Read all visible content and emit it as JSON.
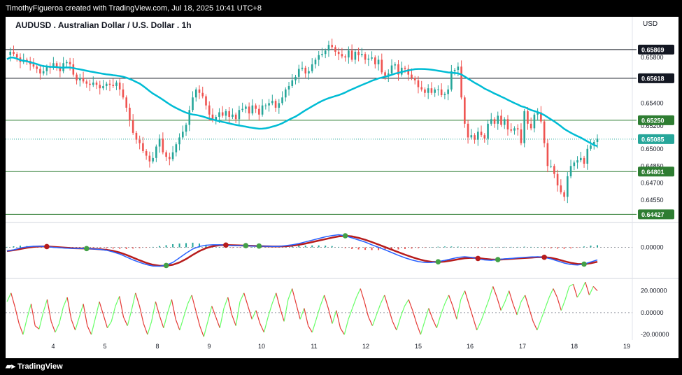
{
  "header": {
    "credit": "TimothyFigueroa created with TradingView.com, Jul 18, 2025 10:41 UTC+8"
  },
  "footer": {
    "brand": "TradingView"
  },
  "chart_title": "AUDUSD . Australian Dollar / U.S. Dollar . 1h",
  "currency": "USD",
  "colors": {
    "up": "#26a69a",
    "down": "#ef5350",
    "ma": "#00bcd4",
    "macd_fast": "#2962ff",
    "macd_slow": "#b71c1c",
    "rsi_up": "#66ff66",
    "rsi_down": "#e53935",
    "hist_up": "#26a69a",
    "hist_down": "#ef5350"
  },
  "chart_data": [
    {
      "type": "line",
      "series_kind": "price_candles",
      "x_ticks": [
        "4",
        "5",
        "8",
        "9",
        "10",
        "11",
        "12",
        "15",
        "16",
        "17",
        "18",
        "19"
      ],
      "y_ticks": [
        "0.65800",
        "0.65400",
        "0.65200",
        "0.65000",
        "0.64850",
        "0.64700",
        "0.64550"
      ],
      "ylim": [
        0.6438,
        0.6596
      ],
      "price_lines": [
        {
          "label": "0.65869",
          "value": 0.65869,
          "style": "black"
        },
        {
          "label": "0.65618",
          "value": 0.65618,
          "style": "black"
        },
        {
          "label": "0.65250",
          "value": 0.6525,
          "style": "green"
        },
        {
          "label": "0.65085",
          "value": 0.65085,
          "style": "current"
        },
        {
          "label": "0.64801",
          "value": 0.64801,
          "style": "green"
        },
        {
          "label": "0.64427",
          "value": 0.64427,
          "style": "green"
        }
      ],
      "close_path": [
        0.6582,
        0.6585,
        0.6583,
        0.658,
        0.6576,
        0.6578,
        0.6577,
        0.6574,
        0.6572,
        0.657,
        0.6566,
        0.6568,
        0.6572,
        0.6571,
        0.6575,
        0.6572,
        0.6568,
        0.6575,
        0.6576,
        0.6574,
        0.6565,
        0.656,
        0.6562,
        0.6559,
        0.6557,
        0.6556,
        0.6558,
        0.6556,
        0.6553,
        0.6555,
        0.6557,
        0.6556,
        0.6555,
        0.6558,
        0.6552,
        0.6545,
        0.6536,
        0.6525,
        0.6514,
        0.6508,
        0.6505,
        0.6498,
        0.6494,
        0.6489,
        0.6492,
        0.6502,
        0.6509,
        0.6497,
        0.6493,
        0.6491,
        0.6497,
        0.6504,
        0.651,
        0.6515,
        0.6521,
        0.6534,
        0.6545,
        0.6552,
        0.6549,
        0.6546,
        0.6538,
        0.653,
        0.6525,
        0.6528,
        0.6532,
        0.6529,
        0.6533,
        0.6528,
        0.653,
        0.6526,
        0.6534,
        0.6535,
        0.6537,
        0.6531,
        0.6538,
        0.6535,
        0.653,
        0.6538,
        0.6538,
        0.654,
        0.6542,
        0.6536,
        0.654,
        0.6545,
        0.6552,
        0.6555,
        0.656,
        0.6563,
        0.657,
        0.6571,
        0.6566,
        0.6568,
        0.6574,
        0.6578,
        0.6582,
        0.6583,
        0.6586,
        0.6591,
        0.6589,
        0.6585,
        0.6583,
        0.6581,
        0.658,
        0.6586,
        0.6578,
        0.6585,
        0.6582,
        0.6583,
        0.6578,
        0.6579,
        0.658,
        0.6574,
        0.6578,
        0.6567,
        0.6564,
        0.6566,
        0.6573,
        0.6574,
        0.6565,
        0.6571,
        0.657,
        0.6565,
        0.6562,
        0.656,
        0.6554,
        0.6552,
        0.6549,
        0.6553,
        0.6549,
        0.6552,
        0.6552,
        0.6547,
        0.6548,
        0.6552,
        0.6568,
        0.6569,
        0.6572,
        0.6545,
        0.6522,
        0.651,
        0.6512,
        0.6508,
        0.6515,
        0.6512,
        0.6509,
        0.6522,
        0.6526,
        0.6522,
        0.6529,
        0.6521,
        0.6526,
        0.6517,
        0.6516,
        0.6518,
        0.6517,
        0.6505,
        0.6533,
        0.6522,
        0.6518,
        0.653,
        0.6532,
        0.6524,
        0.6505,
        0.6485,
        0.6485,
        0.6478,
        0.6468,
        0.6462,
        0.6458,
        0.6476,
        0.6485,
        0.6488,
        0.649,
        0.6492,
        0.6487,
        0.65,
        0.6503,
        0.6506,
        0.6509
      ]
    },
    {
      "type": "line",
      "series_kind": "macd",
      "y_ticks": [
        "0.00000"
      ],
      "ylim": [
        -1.35,
        1.05
      ],
      "fast_path": [
        -0.18,
        -0.12,
        -0.03,
        0.02,
        0.05,
        0.05,
        0.03,
        0.0,
        -0.02,
        -0.04,
        -0.05,
        -0.06,
        -0.06,
        -0.08,
        -0.1,
        -0.14,
        -0.22,
        -0.32,
        -0.46,
        -0.6,
        -0.72,
        -0.82,
        -0.89,
        -0.9,
        -0.85,
        -0.72,
        -0.5,
        -0.28,
        -0.08,
        0.04,
        0.1,
        0.12,
        0.12,
        0.1,
        0.08,
        0.08,
        0.08,
        0.06,
        0.06,
        0.05,
        0.04,
        0.04,
        0.08,
        0.12,
        0.18,
        0.26,
        0.34,
        0.42,
        0.5,
        0.56,
        0.6,
        0.55,
        0.45,
        0.35,
        0.25,
        0.12,
        0.0,
        -0.12,
        -0.25,
        -0.38,
        -0.5,
        -0.6,
        -0.68,
        -0.72,
        -0.72,
        -0.68,
        -0.62,
        -0.55,
        -0.48,
        -0.45,
        -0.48,
        -0.55,
        -0.6,
        -0.62,
        -0.58,
        -0.55,
        -0.53,
        -0.5,
        -0.48,
        -0.46,
        -0.45,
        -0.48,
        -0.55,
        -0.65,
        -0.75,
        -0.82,
        -0.84,
        -0.8,
        -0.7,
        -0.6
      ],
      "slow_path": [
        -0.18,
        -0.14,
        -0.08,
        -0.02,
        0.02,
        0.04,
        0.04,
        0.02,
        0.0,
        -0.02,
        -0.04,
        -0.05,
        -0.06,
        -0.07,
        -0.09,
        -0.12,
        -0.17,
        -0.25,
        -0.36,
        -0.49,
        -0.62,
        -0.74,
        -0.83,
        -0.88,
        -0.88,
        -0.83,
        -0.72,
        -0.56,
        -0.36,
        -0.18,
        -0.04,
        0.05,
        0.1,
        0.11,
        0.1,
        0.09,
        0.08,
        0.07,
        0.06,
        0.05,
        0.04,
        0.04,
        0.05,
        0.08,
        0.12,
        0.18,
        0.25,
        0.32,
        0.39,
        0.46,
        0.52,
        0.55,
        0.52,
        0.45,
        0.36,
        0.25,
        0.13,
        0.01,
        -0.11,
        -0.23,
        -0.35,
        -0.46,
        -0.56,
        -0.64,
        -0.69,
        -0.7,
        -0.68,
        -0.63,
        -0.57,
        -0.52,
        -0.5,
        -0.51,
        -0.55,
        -0.58,
        -0.59,
        -0.57,
        -0.55,
        -0.53,
        -0.51,
        -0.49,
        -0.47,
        -0.47,
        -0.5,
        -0.57,
        -0.66,
        -0.74,
        -0.79,
        -0.8,
        -0.76,
        -0.69
      ],
      "histogram": [
        0.02,
        0.05,
        0.08,
        0.06,
        0.04,
        0.02,
        0.0,
        -0.02,
        -0.03,
        -0.03,
        -0.02,
        -0.02,
        -0.01,
        -0.02,
        -0.03,
        -0.05,
        -0.06,
        -0.07,
        -0.08,
        -0.06,
        -0.04,
        -0.02,
        0.02,
        0.06,
        0.1,
        0.15,
        0.18,
        0.2,
        0.22,
        0.18,
        0.12,
        0.06,
        0.02,
        -0.02,
        -0.03,
        -0.02,
        -0.01,
        0.0,
        0.01,
        0.02,
        0.03,
        0.05,
        0.07,
        0.08,
        0.08,
        0.08,
        0.09,
        0.09,
        0.08,
        0.06,
        0.02,
        -0.04,
        -0.08,
        -0.1,
        -0.12,
        -0.13,
        -0.13,
        -0.12,
        -0.12,
        -0.1,
        -0.08,
        -0.06,
        -0.04,
        -0.02,
        0.01,
        0.03,
        0.04,
        0.04,
        0.03,
        0.01,
        -0.02,
        -0.03,
        -0.02,
        0.01,
        0.02,
        0.02,
        0.02,
        0.02,
        0.03,
        0.02,
        0.01,
        -0.03,
        -0.05,
        -0.06,
        -0.07,
        -0.05,
        -0.02,
        0.04,
        0.08,
        0.1
      ]
    },
    {
      "type": "line",
      "series_kind": "oscillator",
      "y_ticks": [
        "20.00000",
        "0.00000",
        "-20.00000"
      ],
      "ylim": [
        -25,
        30
      ],
      "values": [
        10,
        18,
        5,
        -10,
        -20,
        -5,
        8,
        -12,
        -15,
        0,
        12,
        -8,
        -18,
        -10,
        5,
        14,
        -6,
        -16,
        -4,
        8,
        -12,
        -20,
        -5,
        10,
        -2,
        -14,
        -8,
        6,
        15,
        -4,
        -12,
        2,
        18,
        6,
        -10,
        -20,
        -8,
        10,
        -3,
        -14,
        0,
        12,
        -6,
        -16,
        -4,
        8,
        16,
        2,
        -12,
        -22,
        -8,
        6,
        -4,
        -14,
        4,
        14,
        -2,
        -12,
        10,
        18,
        6,
        -6,
        2,
        -10,
        -18,
        -4,
        8,
        18,
        4,
        -8,
        12,
        22,
        8,
        -6,
        4,
        -12,
        -18,
        -6,
        6,
        16,
        4,
        -10,
        2,
        -14,
        -20,
        -6,
        4,
        14,
        22,
        10,
        -4,
        -12,
        -2,
        8,
        16,
        4,
        -8,
        -16,
        -4,
        6,
        12,
        2,
        -10,
        -20,
        -8,
        4,
        -6,
        -14,
        -2,
        8,
        16,
        6,
        -6,
        12,
        20,
        8,
        -4,
        -16,
        -8,
        2,
        12,
        24,
        14,
        2,
        10,
        20,
        8,
        -2,
        10,
        16,
        4,
        -8,
        -16,
        -6,
        4,
        14,
        22,
        14,
        2,
        12,
        24,
        26,
        14,
        20,
        28,
        16,
        24,
        20
      ]
    }
  ]
}
